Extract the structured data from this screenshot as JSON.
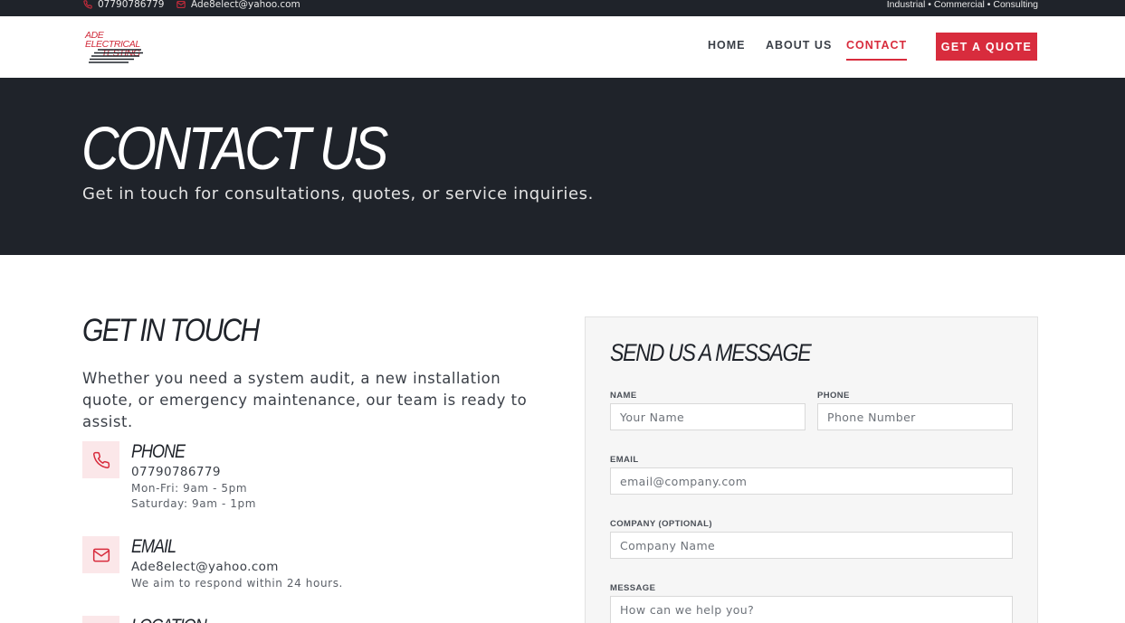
{
  "topbar": {
    "phone": "07790786779",
    "email": "Ade8elect@yahoo.com",
    "services": "Industrial • Commercial • Consulting"
  },
  "header": {
    "logo_line1": "ADE ELECTRICAL",
    "logo_line2": "TESTING",
    "nav": [
      {
        "label": "HOME",
        "active": false
      },
      {
        "label": "ABOUT US",
        "active": false
      },
      {
        "label": "CONTACT",
        "active": true
      }
    ],
    "cta_label": "GET A QUOTE"
  },
  "hero": {
    "title": "CONTACT US",
    "subtitle": "Get in touch for consultations, quotes, or service inquiries."
  },
  "contact_info": {
    "title": "GET IN TOUCH",
    "intro": "Whether you need a system audit, a new installation quote, or emergency maintenance, our team is ready to assist.",
    "phone": {
      "title": "PHONE",
      "number": "07790786779",
      "hours_weekday": "Mon-Fri: 9am - 5pm",
      "hours_saturday": "Saturday: 9am - 1pm"
    },
    "email": {
      "title": "EMAIL",
      "address": "Ade8elect@yahoo.com",
      "note": "We aim to respond within 24 hours."
    },
    "location": {
      "title": "LOCATION"
    }
  },
  "form": {
    "title": "SEND US A MESSAGE",
    "name_label": "NAME",
    "name_placeholder": "Your Name",
    "phone_label": "PHONE",
    "phone_placeholder": "Phone Number",
    "email_label": "EMAIL",
    "email_placeholder": "email@company.com",
    "company_label": "COMPANY (OPTIONAL)",
    "company_placeholder": "Company Name",
    "message_label": "MESSAGE",
    "message_placeholder": "How can we help you?"
  },
  "colors": {
    "accent": "#d82c3d",
    "dark": "#1f232a",
    "icon_bg": "#fbe7e9"
  }
}
